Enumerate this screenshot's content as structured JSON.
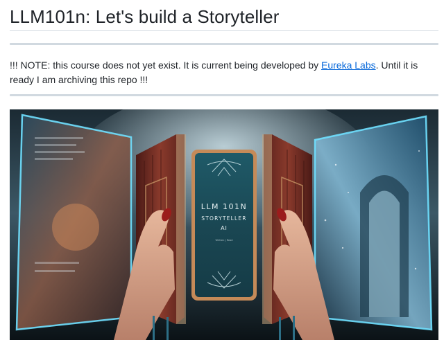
{
  "heading": {
    "title": "LLM101n: Let's build a Storyteller"
  },
  "note": {
    "before_link": "!!! NOTE: this course does not yet exist. It is current being developed by ",
    "link_text": "Eureka Labs",
    "after_link": ". Until it is ready I am archiving this repo !!!"
  },
  "hero_image": {
    "screen_line1": "LLM 101N",
    "screen_line2": "STORYTELLER",
    "screen_line3": "AI",
    "screen_small": "Written | Read",
    "colors": {
      "screen": "#1d4f5c",
      "book_leather": "#7a2a22",
      "glow": "#5fd4f0",
      "sky": "#9fc6d8"
    }
  }
}
